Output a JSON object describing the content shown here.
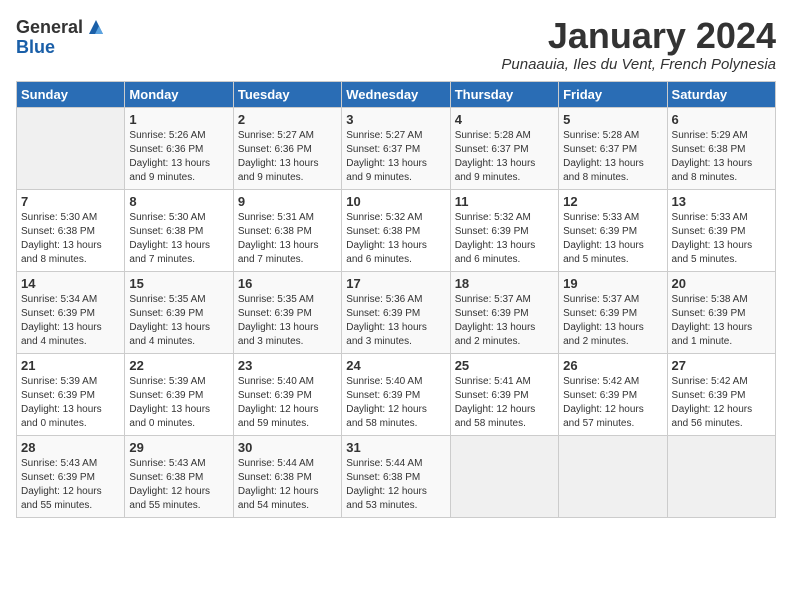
{
  "header": {
    "logo_general": "General",
    "logo_blue": "Blue",
    "title": "January 2024",
    "subtitle": "Punaauia, Iles du Vent, French Polynesia"
  },
  "weekdays": [
    "Sunday",
    "Monday",
    "Tuesday",
    "Wednesday",
    "Thursday",
    "Friday",
    "Saturday"
  ],
  "weeks": [
    [
      {
        "day": "",
        "info": ""
      },
      {
        "day": "1",
        "info": "Sunrise: 5:26 AM\nSunset: 6:36 PM\nDaylight: 13 hours\nand 9 minutes."
      },
      {
        "day": "2",
        "info": "Sunrise: 5:27 AM\nSunset: 6:36 PM\nDaylight: 13 hours\nand 9 minutes."
      },
      {
        "day": "3",
        "info": "Sunrise: 5:27 AM\nSunset: 6:37 PM\nDaylight: 13 hours\nand 9 minutes."
      },
      {
        "day": "4",
        "info": "Sunrise: 5:28 AM\nSunset: 6:37 PM\nDaylight: 13 hours\nand 9 minutes."
      },
      {
        "day": "5",
        "info": "Sunrise: 5:28 AM\nSunset: 6:37 PM\nDaylight: 13 hours\nand 8 minutes."
      },
      {
        "day": "6",
        "info": "Sunrise: 5:29 AM\nSunset: 6:38 PM\nDaylight: 13 hours\nand 8 minutes."
      }
    ],
    [
      {
        "day": "7",
        "info": "Sunrise: 5:30 AM\nSunset: 6:38 PM\nDaylight: 13 hours\nand 8 minutes."
      },
      {
        "day": "8",
        "info": "Sunrise: 5:30 AM\nSunset: 6:38 PM\nDaylight: 13 hours\nand 7 minutes."
      },
      {
        "day": "9",
        "info": "Sunrise: 5:31 AM\nSunset: 6:38 PM\nDaylight: 13 hours\nand 7 minutes."
      },
      {
        "day": "10",
        "info": "Sunrise: 5:32 AM\nSunset: 6:38 PM\nDaylight: 13 hours\nand 6 minutes."
      },
      {
        "day": "11",
        "info": "Sunrise: 5:32 AM\nSunset: 6:39 PM\nDaylight: 13 hours\nand 6 minutes."
      },
      {
        "day": "12",
        "info": "Sunrise: 5:33 AM\nSunset: 6:39 PM\nDaylight: 13 hours\nand 5 minutes."
      },
      {
        "day": "13",
        "info": "Sunrise: 5:33 AM\nSunset: 6:39 PM\nDaylight: 13 hours\nand 5 minutes."
      }
    ],
    [
      {
        "day": "14",
        "info": "Sunrise: 5:34 AM\nSunset: 6:39 PM\nDaylight: 13 hours\nand 4 minutes."
      },
      {
        "day": "15",
        "info": "Sunrise: 5:35 AM\nSunset: 6:39 PM\nDaylight: 13 hours\nand 4 minutes."
      },
      {
        "day": "16",
        "info": "Sunrise: 5:35 AM\nSunset: 6:39 PM\nDaylight: 13 hours\nand 3 minutes."
      },
      {
        "day": "17",
        "info": "Sunrise: 5:36 AM\nSunset: 6:39 PM\nDaylight: 13 hours\nand 3 minutes."
      },
      {
        "day": "18",
        "info": "Sunrise: 5:37 AM\nSunset: 6:39 PM\nDaylight: 13 hours\nand 2 minutes."
      },
      {
        "day": "19",
        "info": "Sunrise: 5:37 AM\nSunset: 6:39 PM\nDaylight: 13 hours\nand 2 minutes."
      },
      {
        "day": "20",
        "info": "Sunrise: 5:38 AM\nSunset: 6:39 PM\nDaylight: 13 hours\nand 1 minute."
      }
    ],
    [
      {
        "day": "21",
        "info": "Sunrise: 5:39 AM\nSunset: 6:39 PM\nDaylight: 13 hours\nand 0 minutes."
      },
      {
        "day": "22",
        "info": "Sunrise: 5:39 AM\nSunset: 6:39 PM\nDaylight: 13 hours\nand 0 minutes."
      },
      {
        "day": "23",
        "info": "Sunrise: 5:40 AM\nSunset: 6:39 PM\nDaylight: 12 hours\nand 59 minutes."
      },
      {
        "day": "24",
        "info": "Sunrise: 5:40 AM\nSunset: 6:39 PM\nDaylight: 12 hours\nand 58 minutes."
      },
      {
        "day": "25",
        "info": "Sunrise: 5:41 AM\nSunset: 6:39 PM\nDaylight: 12 hours\nand 58 minutes."
      },
      {
        "day": "26",
        "info": "Sunrise: 5:42 AM\nSunset: 6:39 PM\nDaylight: 12 hours\nand 57 minutes."
      },
      {
        "day": "27",
        "info": "Sunrise: 5:42 AM\nSunset: 6:39 PM\nDaylight: 12 hours\nand 56 minutes."
      }
    ],
    [
      {
        "day": "28",
        "info": "Sunrise: 5:43 AM\nSunset: 6:39 PM\nDaylight: 12 hours\nand 55 minutes."
      },
      {
        "day": "29",
        "info": "Sunrise: 5:43 AM\nSunset: 6:38 PM\nDaylight: 12 hours\nand 55 minutes."
      },
      {
        "day": "30",
        "info": "Sunrise: 5:44 AM\nSunset: 6:38 PM\nDaylight: 12 hours\nand 54 minutes."
      },
      {
        "day": "31",
        "info": "Sunrise: 5:44 AM\nSunset: 6:38 PM\nDaylight: 12 hours\nand 53 minutes."
      },
      {
        "day": "",
        "info": ""
      },
      {
        "day": "",
        "info": ""
      },
      {
        "day": "",
        "info": ""
      }
    ]
  ]
}
